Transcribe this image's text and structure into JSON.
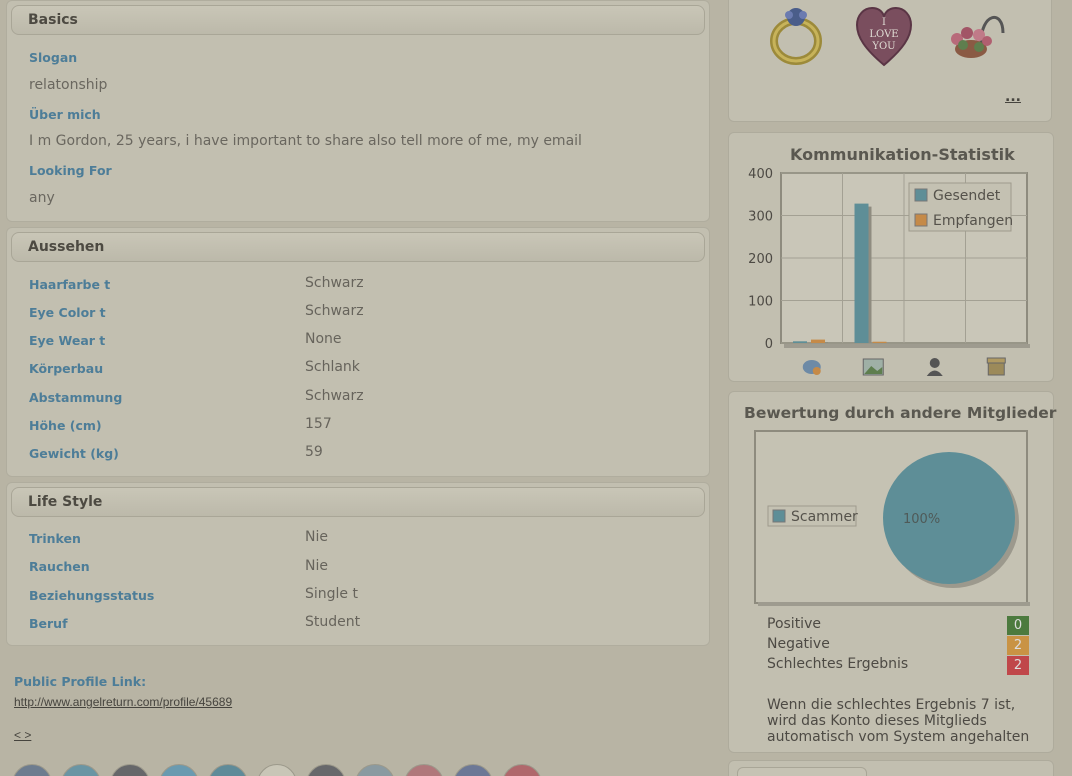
{
  "basics": {
    "title": "Basics",
    "slogan_label": "Slogan",
    "slogan_value": "relatonship",
    "about_label": "Über mich",
    "about_value": "I m Gordon, 25 years, i have important to share also tell more of me, my email",
    "looking_label": "Looking For",
    "looking_value": "any"
  },
  "appearance": {
    "title": "Aussehen",
    "rows": [
      {
        "label": "Haarfarbe t",
        "value": "Schwarz"
      },
      {
        "label": "Eye Color t",
        "value": "Schwarz"
      },
      {
        "label": "Eye Wear t",
        "value": "None"
      },
      {
        "label": "Körperbau",
        "value": "Schlank"
      },
      {
        "label": "Abstammung",
        "value": "Schwarz"
      },
      {
        "label": "Höhe (cm)",
        "value": "157"
      },
      {
        "label": "Gewicht (kg)",
        "value": "59"
      }
    ]
  },
  "lifestyle": {
    "title": "Life Style",
    "rows": [
      {
        "label": "Trinken",
        "value": "Nie"
      },
      {
        "label": "Rauchen",
        "value": "Nie"
      },
      {
        "label": "Beziehungsstatus",
        "value": "Single t"
      },
      {
        "label": "Beruf",
        "value": "Student"
      }
    ]
  },
  "public_link": {
    "label": "Public Profile Link:",
    "url": "http://www.angelreturn.com/profile/45689",
    "pager": "< >"
  },
  "gifts": {
    "icons": [
      "ring-icon",
      "heart-i-love-you-icon",
      "flower-basket-icon"
    ],
    "heart_text": "I LOVE YOU",
    "more_link": "..."
  },
  "colors": {
    "series_sent": "#5e8e97",
    "series_received": "#c58a48",
    "positive": "#4c7a3e",
    "negative": "#c99344",
    "bad": "#c0474a"
  },
  "chart_data": [
    {
      "type": "bar",
      "title": "Kommunikation-Statistik",
      "categories": [
        "messages-icon",
        "photos-icon",
        "profile-views-icon",
        "gifts-icon"
      ],
      "series": [
        {
          "name": "Gesendet",
          "values": [
            4,
            328,
            0,
            0
          ]
        },
        {
          "name": "Empfangen",
          "values": [
            8,
            3,
            0,
            0
          ]
        }
      ],
      "yticks": [
        "400",
        "300",
        "200",
        "100",
        "0"
      ],
      "ylim": [
        0,
        400
      ],
      "grid": true,
      "legend": "top-right"
    },
    {
      "type": "pie",
      "title": "Bewertung durch andere Mitglieder",
      "labels": [
        "Scammer"
      ],
      "values": [
        100
      ],
      "data_labels": [
        "100%"
      ],
      "legend": "left"
    }
  ],
  "rating": {
    "rows": [
      {
        "label": "Positive",
        "count": "0",
        "color_key": "positive"
      },
      {
        "label": "Negative",
        "count": "2",
        "color_key": "negative"
      },
      {
        "label": "Schlechtes Ergebnis",
        "count": "2",
        "color_key": "bad"
      }
    ],
    "note_line1": "Wenn die schlechtes Ergebnis 7 ist,",
    "note_line2": "wird das Konto dieses Mitglieds",
    "note_line3": "automatisch vom System angehalten"
  }
}
